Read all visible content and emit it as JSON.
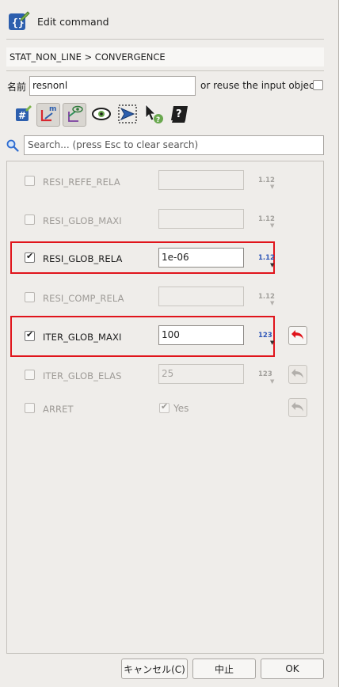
{
  "window": {
    "title": "Edit command"
  },
  "breadcrumb": "STAT_NON_LINE > CONVERGENCE",
  "name_field": {
    "label": "名前",
    "value": "resnonl",
    "reuse_label": "or reuse the input object"
  },
  "toolbar": {
    "icons": [
      "hash-edit-icon",
      "mesh-edit-icon",
      "eye-split-icon",
      "eye-icon",
      "select-tool-icon",
      "pointer-help-icon",
      "help-book-icon"
    ]
  },
  "search": {
    "placeholder": "Search... (press Esc to clear search)"
  },
  "keywords": [
    {
      "name": "RESI_REFE_RELA",
      "checked": false,
      "value": "",
      "type": "1.12"
    },
    {
      "name": "RESI_GLOB_MAXI",
      "checked": false,
      "value": "",
      "type": "1.12"
    },
    {
      "name": "RESI_GLOB_RELA",
      "checked": true,
      "value": "1e-06",
      "type": "1.12"
    },
    {
      "name": "RESI_COMP_RELA",
      "checked": false,
      "value": "",
      "type": "1.12"
    },
    {
      "name": "ITER_GLOB_MAXI",
      "checked": true,
      "value": "100",
      "type": "123"
    },
    {
      "name": "ITER_GLOB_ELAS",
      "checked": false,
      "value": "25",
      "type": "123"
    },
    {
      "name": "ARRET",
      "checked": false,
      "value": "Yes",
      "type": ""
    }
  ],
  "buttons": {
    "cancel": "キャンセル(C)",
    "abort": "中止",
    "ok": "OK"
  },
  "colors": {
    "highlight": "#e0141b",
    "undo_active": "#e0141b",
    "type_active": "#2f57b8"
  }
}
